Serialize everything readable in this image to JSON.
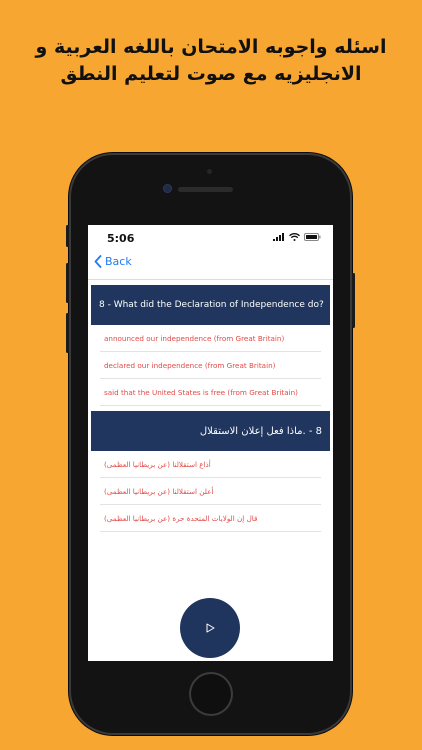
{
  "headline": {
    "line1": "اسئله واجوبه الامتحان باللغه العربية و",
    "line2": "الانجليزيه مع صوت لتعليم النطق"
  },
  "status": {
    "time": "5:06",
    "icons": [
      "signal-icon",
      "wifi-icon",
      "battery-icon"
    ]
  },
  "nav": {
    "back_label": "Back",
    "back_icon": "chevron-left-icon"
  },
  "question_en": {
    "text": "8 - What did the Declaration of Independence do?",
    "answers": [
      "announced our independence (from Great Britain)",
      "declared our independence (from Great Britain)",
      "said that the United States is free (from Great Britain)"
    ]
  },
  "question_ar": {
    "text": "8 - .ماذا فعل إعلان الاستقلال",
    "answers": [
      "أذاع استقلالنا (عن بريطانيا العظمى)",
      "أعلن استقلالنا (عن بريطانيا العظمى)",
      "قال إن الولايات المتحدة حرة (عن بريطانيا العظمى)"
    ]
  },
  "play_button": {
    "icon": "play-icon"
  },
  "colors": {
    "background": "#F8A632",
    "question_bg": "#20365F",
    "answer_text": "#E04B48",
    "link": "#1F7BF6",
    "play_button": "#1F355D"
  }
}
